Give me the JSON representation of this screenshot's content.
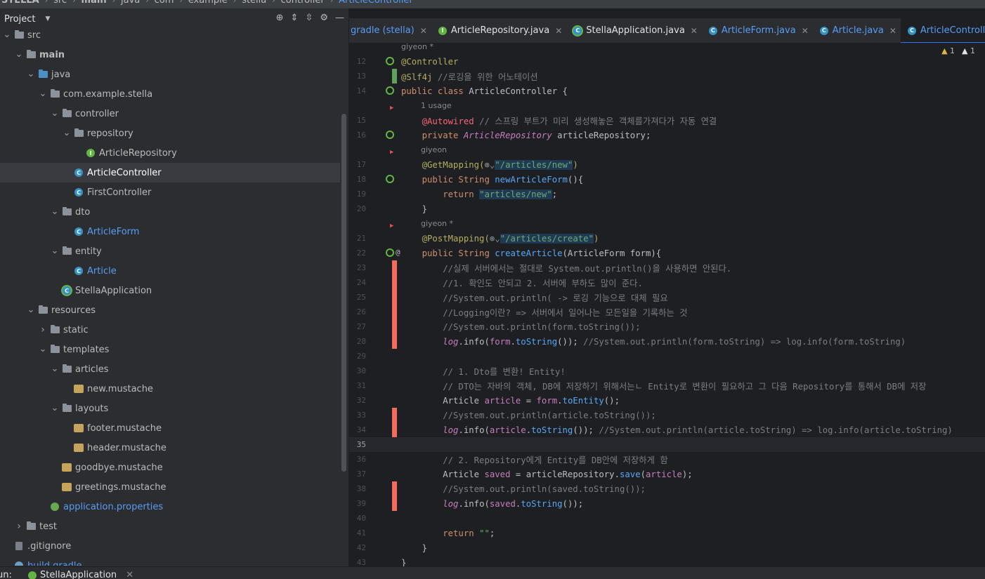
{
  "breadcrumb": {
    "project": "STELLA",
    "items": [
      "src",
      "main",
      "java",
      "com",
      "example",
      "stella",
      "controller"
    ],
    "file": "ArticleController"
  },
  "project_panel": {
    "title": "Project",
    "tree": [
      {
        "label": "src",
        "depth": 1,
        "kind": "folder",
        "expanded": true
      },
      {
        "label": "main",
        "depth": 2,
        "kind": "folder",
        "expanded": true,
        "bold": true
      },
      {
        "label": "java",
        "depth": 3,
        "kind": "folder-blue",
        "expanded": true
      },
      {
        "label": "com.example.stella",
        "depth": 4,
        "kind": "folder",
        "expanded": true
      },
      {
        "label": "controller",
        "depth": 5,
        "kind": "folder",
        "expanded": true
      },
      {
        "label": "repository",
        "depth": 6,
        "kind": "folder",
        "expanded": true
      },
      {
        "label": "ArticleRepository",
        "depth": 7,
        "kind": "interface"
      },
      {
        "label": "ArticleController",
        "depth": 6,
        "kind": "class",
        "selected": true
      },
      {
        "label": "FirstController",
        "depth": 6,
        "kind": "class"
      },
      {
        "label": "dto",
        "depth": 5,
        "kind": "folder",
        "expanded": true
      },
      {
        "label": "ArticleForm",
        "depth": 6,
        "kind": "class",
        "color": "blue"
      },
      {
        "label": "entity",
        "depth": 5,
        "kind": "folder",
        "expanded": true
      },
      {
        "label": "Article",
        "depth": 6,
        "kind": "class",
        "color": "blue"
      },
      {
        "label": "StellaApplication",
        "depth": 5,
        "kind": "spring"
      },
      {
        "label": "resources",
        "depth": 3,
        "kind": "folder-res",
        "expanded": true
      },
      {
        "label": "static",
        "depth": 4,
        "kind": "folder",
        "expanded": false
      },
      {
        "label": "templates",
        "depth": 4,
        "kind": "folder",
        "expanded": true
      },
      {
        "label": "articles",
        "depth": 5,
        "kind": "folder",
        "expanded": true
      },
      {
        "label": "new.mustache",
        "depth": 6,
        "kind": "mustache"
      },
      {
        "label": "layouts",
        "depth": 5,
        "kind": "folder",
        "expanded": true
      },
      {
        "label": "footer.mustache",
        "depth": 6,
        "kind": "mustache"
      },
      {
        "label": "header.mustache",
        "depth": 6,
        "kind": "mustache"
      },
      {
        "label": "goodbye.mustache",
        "depth": 5,
        "kind": "mustache"
      },
      {
        "label": "greetings.mustache",
        "depth": 5,
        "kind": "mustache"
      },
      {
        "label": "application.properties",
        "depth": 4,
        "kind": "properties",
        "color": "blue"
      },
      {
        "label": "test",
        "depth": 2,
        "kind": "folder",
        "expanded": false
      },
      {
        "label": ".gitignore",
        "depth": 1,
        "kind": "file"
      },
      {
        "label": "build.gradle",
        "depth": 1,
        "kind": "gradle",
        "color": "blue"
      }
    ]
  },
  "tabs": [
    {
      "label": "gradle (stella)",
      "kind": "none",
      "color": "blue"
    },
    {
      "label": "ArticleRepository.java",
      "kind": "interface"
    },
    {
      "label": "StellaApplication.java",
      "kind": "spring"
    },
    {
      "label": "ArticleForm.java",
      "kind": "class",
      "color": "blue"
    },
    {
      "label": "Article.java",
      "kind": "class",
      "color": "blue"
    },
    {
      "label": "ArticleController.java",
      "kind": "class",
      "color": "blue",
      "active": true
    }
  ],
  "editor": {
    "warnings": [
      "1",
      "1"
    ],
    "hints": {
      "h11": "giyeon *",
      "h15": "1 usage",
      "h17": "giyeon",
      "h21": "giyeon *"
    },
    "lines": {
      "l12": [
        "@Controller"
      ],
      "l13": [
        "@Slf4j",
        " //로깅을 위한 어노테이션"
      ],
      "l14": [
        "public class ",
        "ArticleController",
        " {"
      ],
      "l15": [
        "    ",
        "@Autowired",
        " // 스프링 부트가 미리 생성해놓은 객체를가져다가 자동 연결"
      ],
      "l16": [
        "    private ",
        "ArticleRepository",
        " articleRepository;"
      ],
      "l17": [
        "    ",
        "@GetMapping",
        "(",
        "\"/articles/new\"",
        ")"
      ],
      "l18": [
        "    public String ",
        "newArticleForm",
        "(){"
      ],
      "l19": [
        "        return ",
        "\"articles/new\"",
        ";"
      ],
      "l20": [
        "    }"
      ],
      "l21": [
        "    ",
        "@PostMapping",
        "(",
        "\"/articles/create\"",
        ")"
      ],
      "l22": [
        "    public String ",
        "createArticle",
        "(ArticleForm form){"
      ],
      "l23": [
        "        //실제 서버에서는 절대로 System.out.println()을 사용하면 안된다."
      ],
      "l24": [
        "        //1. 확인도 안되고 2. 서버에 부하도 많이 준다."
      ],
      "l25": [
        "        //System.out.println( -> 로깅 기능으로 대체 필요"
      ],
      "l26": [
        "        //Logging이란? => 서버에서 일어나는 모든일을 기록하는 것"
      ],
      "l27": [
        "        //System.out.println(form.toString());"
      ],
      "l28": [
        "        ",
        "log",
        ".info(",
        "form",
        ".",
        "toString",
        "()); ",
        "//System.out.println(form.toString) => log.info(form.toString)"
      ],
      "l30": [
        "        // 1. Dto를 변환! Entity!"
      ],
      "l31": [
        "        // DTO는 자바의 객체, DB에 저장하기 위해서는ㄴ Entity로 변환이 필요하고 그 다음 Repository를 통해서 DB에 저장"
      ],
      "l32": [
        "        Article ",
        "article",
        " = ",
        "form",
        ".",
        "toEntity",
        "();"
      ],
      "l33": [
        "        //System.out.println(article.toString());"
      ],
      "l34": [
        "        ",
        "log",
        ".info(",
        "article",
        ".",
        "toString",
        "()); ",
        "//System.out.println(article.toString) => log.info(article.toString)"
      ],
      "l36": [
        "        // 2. Repository에게 Entity를 DB안에 저장하게 함"
      ],
      "l37": [
        "        Article ",
        "saved",
        " = articleRepository.",
        "save",
        "(",
        "article",
        ");"
      ],
      "l38": [
        "        //System.out.println(saved.toString());"
      ],
      "l39": [
        "        ",
        "log",
        ".info(",
        "saved",
        ".",
        "toString",
        "());"
      ],
      "l41": [
        "        return ",
        "\"\"",
        ";"
      ],
      "l42": [
        "    }"
      ],
      "l43": [
        "}"
      ]
    },
    "line_numbers": [
      "12",
      "13",
      "14",
      "15",
      "16",
      "17",
      "18",
      "19",
      "20",
      "21",
      "22",
      "23",
      "24",
      "25",
      "26",
      "27",
      "28",
      "29",
      "30",
      "31",
      "32",
      "33",
      "34",
      "35",
      "36",
      "37",
      "38",
      "39",
      "40",
      "41",
      "42",
      "43"
    ]
  },
  "bottom": {
    "run_label": "un:",
    "app": "StellaApplication"
  },
  "colors": {
    "accent": "#3574f0",
    "change_marker": "#f26b5b",
    "spring_green": "#62b543"
  }
}
